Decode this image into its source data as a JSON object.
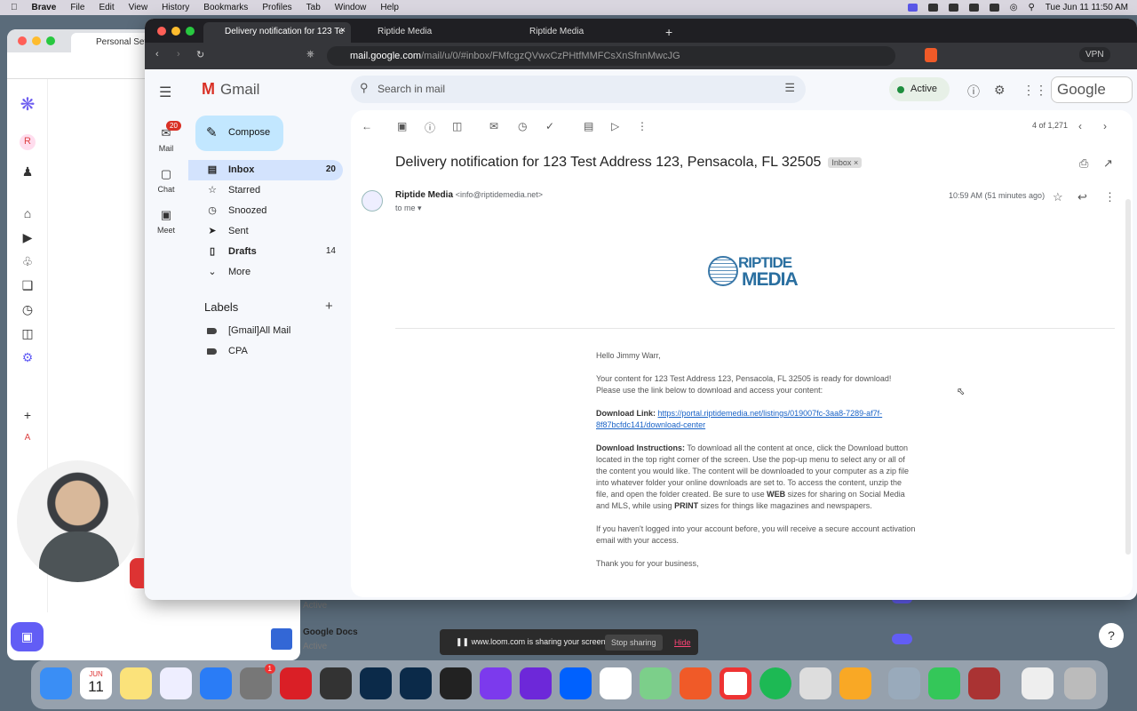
{
  "menubar": {
    "app": "Brave",
    "items": [
      "File",
      "Edit",
      "View",
      "History",
      "Bookmarks",
      "Profiles",
      "Tab",
      "Window",
      "Help"
    ],
    "clock": "Tue Jun 11  11:50 AM"
  },
  "bg_window": {
    "tab": "Personal Sett",
    "avatar_letter": "R",
    "row1_status": "Active",
    "row2_title": "Google Docs",
    "row2_status": "Active",
    "app_letter": "A"
  },
  "browser": {
    "tabs": [
      "Delivery notification for 123 Te",
      "Riptide Media",
      "Riptide Media"
    ],
    "url_domain": "mail.google.com",
    "url_path": "/mail/u/0/#inbox/FMfcgzQVwxCzPHtfMMFCsXnSfnnMwcJG",
    "vpn": "VPN"
  },
  "gmail": {
    "brand": "Gmail",
    "search_placeholder": "Search in mail",
    "status": "Active",
    "google": "Google",
    "rail": [
      {
        "label": "Mail",
        "badge": "20"
      },
      {
        "label": "Chat"
      },
      {
        "label": "Meet"
      }
    ],
    "compose": "Compose",
    "folders": [
      {
        "label": "Inbox",
        "count": "20",
        "icon": "inbox-icon"
      },
      {
        "label": "Starred",
        "count": "",
        "icon": "star-icon"
      },
      {
        "label": "Snoozed",
        "count": "",
        "icon": "clock-icon"
      },
      {
        "label": "Sent",
        "count": "",
        "icon": "send-icon"
      },
      {
        "label": "Drafts",
        "count": "14",
        "icon": "draft-icon"
      },
      {
        "label": "More",
        "count": "",
        "icon": "chevron-down-icon"
      }
    ],
    "labels_header": "Labels",
    "labels": [
      "[Gmail]All Mail",
      "CPA"
    ]
  },
  "email": {
    "pager": "4 of 1,271",
    "subject": "Delivery notification for 123 Test Address 123, Pensacola, FL 32505",
    "chip": "Inbox",
    "sender_name": "Riptide Media",
    "sender_email": "<info@riptidemedia.net>",
    "to": "to me",
    "time": "10:59 AM (51 minutes ago)",
    "logo_top": "RIPTIDE",
    "logo_bottom": "MEDIA",
    "greeting": "Hello Jimmy Warr,",
    "p1": "Your content for 123 Test Address 123, Pensacola, FL 32505 is ready for download! Please use the link below to download and access your content:",
    "link_label": "Download Link:",
    "link": "https://portal.riptidemedia.net/listings/019007fc-3aa8-7289-af7f-8f87bcfdc141/download-center",
    "instr_label": "Download Instructions:",
    "instr_a": "To download all the content at once, click the Download button located in the top right corner of the screen. Use the pop-up menu to select any or all of the content you would like. The content will be downloaded to your computer as a zip file into whatever folder your online downloads are set to. To access the content, unzip the file, and open the folder created. Be sure to use",
    "web": "WEB",
    "instr_b": "sizes for sharing on Social Media and MLS, while using",
    "print": "PRINT",
    "instr_c": "sizes for things like magazines and newspapers.",
    "p3": "If you haven't logged into your account before, you will receive a secure account activation email with your access.",
    "thanks": "Thank you for your business,"
  },
  "loom": {
    "message": "www.loom.com is sharing your screen.",
    "stop": "Stop sharing",
    "hide": "Hide"
  },
  "dock": {
    "calendar_month": "JUN",
    "calendar_day": "11",
    "badge": "1"
  },
  "colors": {
    "accent": "#0b57d0",
    "compose": "#c2e7ff",
    "selected": "#d3e3fd"
  }
}
